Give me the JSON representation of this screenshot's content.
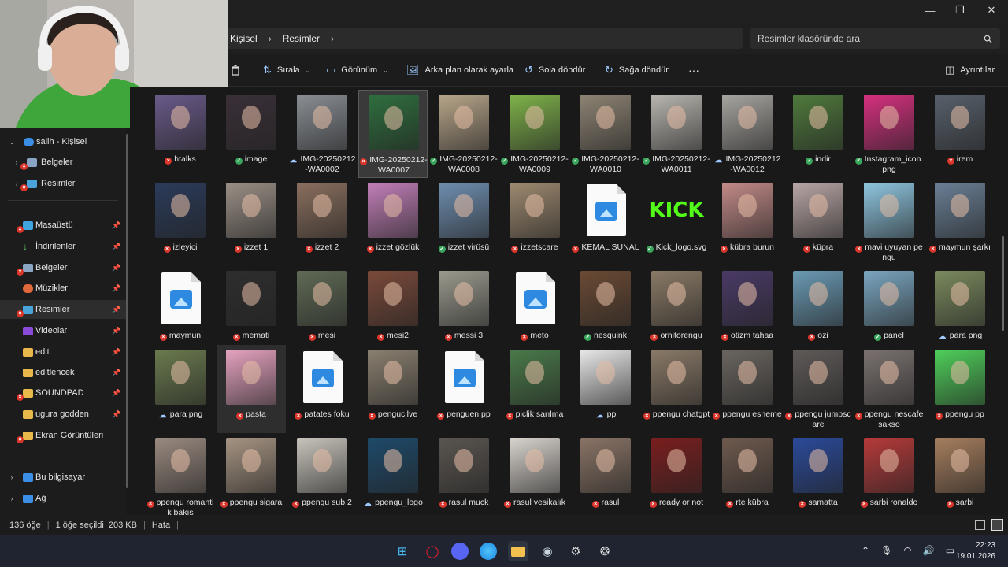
{
  "window": {
    "minimize": "—",
    "maximize": "❐",
    "close": "✕"
  },
  "address": {
    "crumbs": [
      "Kişisel",
      "Resimler"
    ],
    "sep": "›",
    "search_placeholder": "Resimler klasöründe ara"
  },
  "toolbar": {
    "sort": "Sırala",
    "view": "Görünüm",
    "set_bg": "Arka plan olarak ayarla",
    "rotate_left": "Sola döndür",
    "rotate_right": "Sağa döndür",
    "more": "···",
    "details": "Ayrıntılar"
  },
  "sidebar": {
    "onedrive": "salih - Kişisel",
    "items": [
      {
        "label": "Belgeler"
      },
      {
        "label": "Resimler"
      },
      {
        "label": "Masaüstü"
      },
      {
        "label": "İndirilenler"
      },
      {
        "label": "Belgeler"
      },
      {
        "label": "Müzikler"
      },
      {
        "label": "Resimler"
      },
      {
        "label": "Videolar"
      },
      {
        "label": "edit"
      },
      {
        "label": "editlencek"
      },
      {
        "label": "SOUNDPAD"
      },
      {
        "label": "ugura godden"
      },
      {
        "label": "Ekran Görüntüleri"
      },
      {
        "label": "Bu bilgisayar"
      },
      {
        "label": "Ağ"
      }
    ]
  },
  "files": [
    {
      "name": "htalks",
      "status": "x",
      "color": "#6a5a8a"
    },
    {
      "name": "image",
      "status": "ok",
      "color": "#3a3038"
    },
    {
      "name": "IMG-20250212-WA0002",
      "status": "cloud",
      "color": "#8a8f95"
    },
    {
      "name": "IMG-20250212-WA0007",
      "status": "x",
      "color": "#2f6e3e",
      "selected": true
    },
    {
      "name": "IMG-20250212-WA0008",
      "status": "ok",
      "color": "#b8a68a"
    },
    {
      "name": "IMG-20250212-WA0009",
      "status": "ok",
      "color": "#7fb34a"
    },
    {
      "name": "IMG-20250212-WA0010",
      "status": "ok",
      "color": "#8e8474"
    },
    {
      "name": "IMG-20250212-WA0011",
      "status": "ok",
      "color": "#b9b6b0"
    },
    {
      "name": "IMG-20250212-WA0012",
      "status": "cloud",
      "color": "#a7a5a0"
    },
    {
      "name": "indir",
      "status": "ok",
      "color": "#4f7a3c"
    },
    {
      "name": "Instagram_icon.png",
      "status": "ok",
      "color": "#d6307f"
    },
    {
      "name": "irem",
      "status": "x",
      "color": "#57606b"
    },
    {
      "name": "izleyici",
      "status": "x",
      "color": "#2b3b5a"
    },
    {
      "name": "izzet 1",
      "status": "x",
      "color": "#9a8f86"
    },
    {
      "name": "izzet 2",
      "status": "x",
      "color": "#8a6f5e"
    },
    {
      "name": "izzet gözlük",
      "status": "x",
      "color": "#c27fb8"
    },
    {
      "name": "izzet virüsü",
      "status": "ok",
      "color": "#6f8eb0"
    },
    {
      "name": "izzetscare",
      "status": "x",
      "color": "#9e8a70"
    },
    {
      "name": "KEMAL SUNAL",
      "status": "x",
      "color": "doc"
    },
    {
      "name": "Kick_logo.svg",
      "status": "ok",
      "color": "kick"
    },
    {
      "name": "kübra burun",
      "status": "x",
      "color": "#c28a88"
    },
    {
      "name": "küpra",
      "status": "x",
      "color": "#b8a5a5"
    },
    {
      "name": "mavi uyuyan pengu",
      "status": "x",
      "color": "#8fc6e0"
    },
    {
      "name": "maymun şarkı",
      "status": "x",
      "color": "#6a7f95"
    },
    {
      "name": "maymun",
      "status": "x",
      "color": "doc"
    },
    {
      "name": "memati",
      "status": "x",
      "color": "#2e2e2e"
    },
    {
      "name": "mesi",
      "status": "x",
      "color": "#5f6a55"
    },
    {
      "name": "mesi2",
      "status": "x",
      "color": "#7a4a3a"
    },
    {
      "name": "messi 3",
      "status": "x",
      "color": "#9a9a8e"
    },
    {
      "name": "meto",
      "status": "x",
      "color": "doc"
    },
    {
      "name": "nesquink",
      "status": "ok",
      "color": "#6a4a34"
    },
    {
      "name": "ornitorengu",
      "status": "x",
      "color": "#8a7a66"
    },
    {
      "name": "otizm tahaa",
      "status": "x",
      "color": "#4a3a66"
    },
    {
      "name": "ozi",
      "status": "x",
      "color": "#6a9ab4"
    },
    {
      "name": "panel",
      "status": "ok",
      "color": "#7aa6c0"
    },
    {
      "name": "para png",
      "status": "cloud",
      "color": "#7a8a5e"
    },
    {
      "name": "para png",
      "status": "cloud",
      "color": "#6a7a4e"
    },
    {
      "name": "pasta",
      "status": "x",
      "color": "#e6a3c0",
      "hover": true
    },
    {
      "name": "patates foku",
      "status": "x",
      "color": "doc"
    },
    {
      "name": "pengucilve",
      "status": "x",
      "color": "#8a8070"
    },
    {
      "name": "penguen pp",
      "status": "x",
      "color": "doc"
    },
    {
      "name": "piclik sarılma",
      "status": "x",
      "color": "#4a7a4a"
    },
    {
      "name": "pp",
      "status": "cloud",
      "color": "#e8e8e8"
    },
    {
      "name": "ppengu chatgpt",
      "status": "x",
      "color": "#8a7a68"
    },
    {
      "name": "ppengu esneme",
      "status": "x",
      "color": "#6a6560"
    },
    {
      "name": "ppengu jumpscare",
      "status": "x",
      "color": "#5e5a58"
    },
    {
      "name": "ppengu nescafe sakso",
      "status": "x",
      "color": "#7a7270"
    },
    {
      "name": "ppengu pp",
      "status": "x",
      "color": "#4fcf5a"
    },
    {
      "name": "ppengu romantik bakış",
      "status": "x",
      "color": "#9a8a80"
    },
    {
      "name": "ppengu sigara",
      "status": "x",
      "color": "#a69482"
    },
    {
      "name": "ppengu sub 2",
      "status": "x",
      "color": "#c8c4bc"
    },
    {
      "name": "ppengu_logo",
      "status": "cloud",
      "color": "#1e4a6a"
    },
    {
      "name": "rasul muck",
      "status": "x",
      "color": "#5a5550"
    },
    {
      "name": "rasul vesikalık",
      "status": "x",
      "color": "#d9d4ce"
    },
    {
      "name": "rasul",
      "status": "x",
      "color": "#8a7466"
    },
    {
      "name": "ready or not",
      "status": "x",
      "color": "#7a1e1e"
    },
    {
      "name": "rte kübra",
      "status": "x",
      "color": "#6e5a4e"
    },
    {
      "name": "samatta",
      "status": "x",
      "color": "#2a4a9a"
    },
    {
      "name": "sarbi ronaldo",
      "status": "x",
      "color": "#b63a3a"
    },
    {
      "name": "sarbi",
      "status": "x",
      "color": "#a67e5e"
    }
  ],
  "status": {
    "count": "136 öğe",
    "selected": "1 öğe seçildi  203 KB",
    "error": "Hata"
  },
  "tray": {
    "time": "22:23",
    "date": "19.01.2026"
  }
}
